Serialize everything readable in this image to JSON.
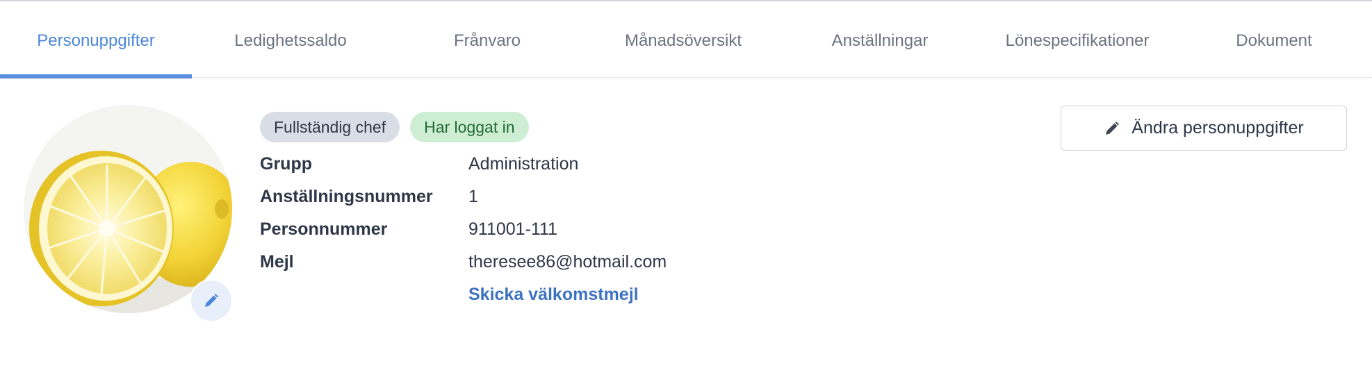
{
  "tabs": [
    {
      "label": "Personuppgifter",
      "active": true
    },
    {
      "label": "Ledighetssaldo",
      "active": false
    },
    {
      "label": "Frånvaro",
      "active": false
    },
    {
      "label": "Månadsöversikt",
      "active": false
    },
    {
      "label": "Anställningar",
      "active": false
    },
    {
      "label": "Lönespecifikationer",
      "active": false
    },
    {
      "label": "Dokument",
      "active": false
    }
  ],
  "profile": {
    "badges": {
      "role": "Fullständig chef",
      "status": "Har loggat in"
    },
    "fields": [
      {
        "label": "Grupp",
        "value": "Administration"
      },
      {
        "label": "Anställningsnummer",
        "value": "1"
      },
      {
        "label": "Personnummer",
        "value": "911001-111"
      },
      {
        "label": "Mejl",
        "value": "theresee86@hotmail.com"
      }
    ],
    "welcome_link": "Skicka välkomstmejl",
    "avatar_icon": "lemon-photo",
    "avatar_edit_icon": "pencil-icon"
  },
  "actions": {
    "edit_label": "Ändra personuppgifter",
    "edit_icon": "pencil-icon"
  },
  "colors": {
    "accent": "#4a86d6",
    "tab_underline": "#5b8fe0",
    "link": "#3d72c2",
    "role_badge_bg": "#d9dde5",
    "status_badge_bg": "#cdeed3",
    "status_badge_text": "#256b35"
  }
}
